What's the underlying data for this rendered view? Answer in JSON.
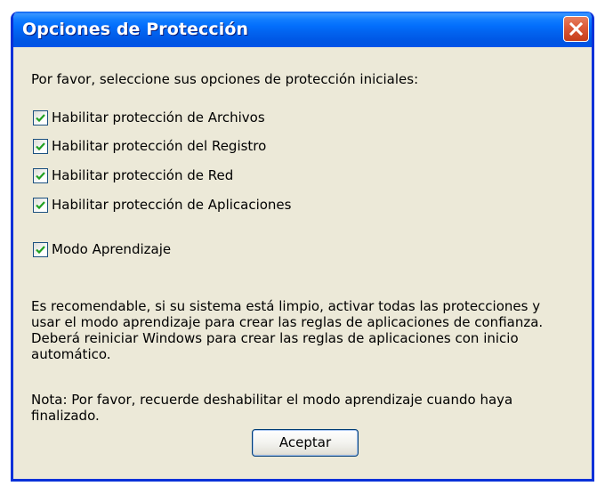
{
  "window": {
    "title": "Opciones de Protección",
    "close_icon": "close-icon"
  },
  "intro_text": "Por favor, seleccione sus opciones de protección iniciales:",
  "options": [
    {
      "label": "Habilitar protección de Archivos",
      "checked": true
    },
    {
      "label": "Habilitar protección del Registro",
      "checked": true
    },
    {
      "label": "Habilitar protección de Red",
      "checked": true
    },
    {
      "label": "Habilitar protección de Aplicaciones",
      "checked": true
    },
    {
      "label": "Modo Aprendizaje",
      "checked": true
    }
  ],
  "recommendation": [
    "Es recomendable, si su sistema está limpio, activar todas las protecciones y",
    "usar el modo aprendizaje para crear las reglas de aplicaciones de confianza.",
    "Deberá reiniciar Windows para crear las reglas de aplicaciones con inicio",
    "automático."
  ],
  "note": [
    "Nota: Por favor, recuerde deshabilitar el modo aprendizaje cuando haya",
    "finalizado."
  ],
  "buttons": {
    "ok_label": "Aceptar"
  },
  "colors": {
    "titlebar": "#0055e5",
    "window_bg": "#ece9d8",
    "close_button": "#dc5a38",
    "check_mark": "#21a121"
  }
}
